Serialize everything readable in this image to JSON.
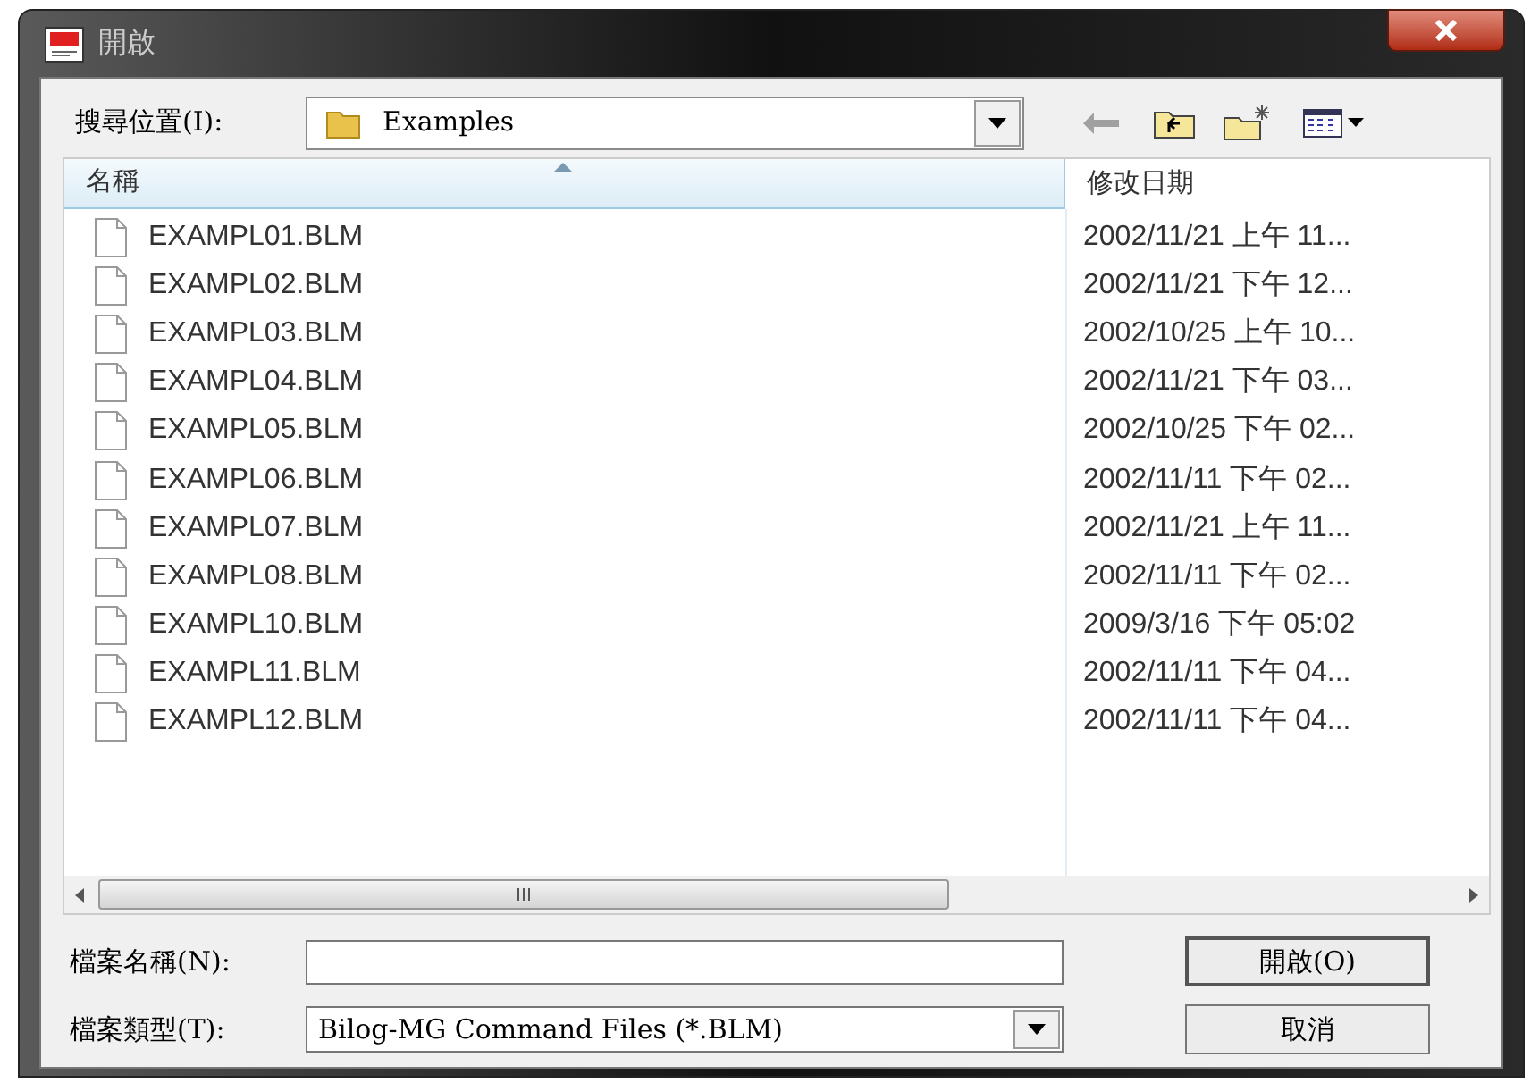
{
  "window": {
    "title": "開啟"
  },
  "location": {
    "label": "搜尋位置(I):",
    "value": "Examples"
  },
  "columns": [
    {
      "label": "名稱",
      "sorted": true
    },
    {
      "label": "修改日期",
      "sorted": false
    }
  ],
  "files": [
    {
      "name": "EXAMPL01.BLM",
      "modified": "2002/11/21 上午 11..."
    },
    {
      "name": "EXAMPL02.BLM",
      "modified": "2002/11/21 下午 12..."
    },
    {
      "name": "EXAMPL03.BLM",
      "modified": "2002/10/25 上午 10..."
    },
    {
      "name": "EXAMPL04.BLM",
      "modified": "2002/11/21 下午 03..."
    },
    {
      "name": "EXAMPL05.BLM",
      "modified": "2002/10/25 下午 02..."
    },
    {
      "name": "EXAMPL06.BLM",
      "modified": "2002/11/11 下午 02..."
    },
    {
      "name": "EXAMPL07.BLM",
      "modified": "2002/11/21 上午 11..."
    },
    {
      "name": "EXAMPL08.BLM",
      "modified": "2002/11/11 下午 02..."
    },
    {
      "name": "EXAMPL10.BLM",
      "modified": "2009/3/16 下午 05:02"
    },
    {
      "name": "EXAMPL11.BLM",
      "modified": "2002/11/11 下午 04..."
    },
    {
      "name": "EXAMPL12.BLM",
      "modified": "2002/11/11 下午 04..."
    }
  ],
  "file_name": {
    "label": "檔案名稱(N):"
  },
  "file_type": {
    "label": "檔案類型(T):",
    "value": "Bilog-MG Command Files (*.BLM)"
  },
  "buttons": [
    "開啟(O)",
    "取消"
  ]
}
